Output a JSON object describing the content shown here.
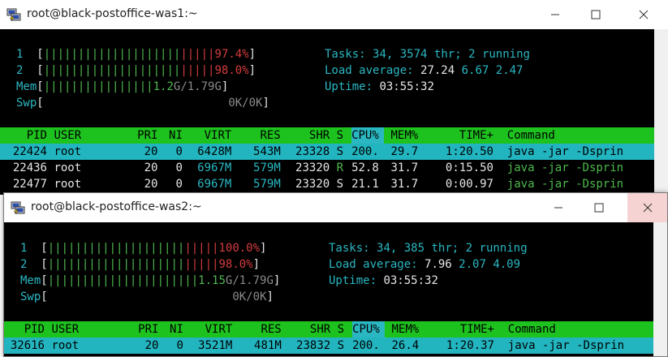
{
  "windows": [
    {
      "title": "root@black-postoffice-was1:~",
      "buttons": {
        "minimize": "—",
        "maximize": "☐",
        "close": "✕"
      },
      "cpu1": {
        "label": "1",
        "bar_green": "||||||||||||||||||||",
        "bar_red": "|||||",
        "value": "97.4%"
      },
      "cpu2": {
        "label": "2",
        "bar_green": "||||||||||||||||||||",
        "bar_red": "|||||",
        "value": "98.0%"
      },
      "mem": {
        "label": "Mem",
        "bar": "||||||||||||||||",
        "value": "1.2",
        "value2": "G/1.79G"
      },
      "swp": {
        "label": "Swp",
        "value": "0K/0K"
      },
      "tasks": {
        "label": "Tasks:",
        "count": "34,",
        "threads": "3574",
        "thr_label": "thr;",
        "running": "2",
        "running_label": "running"
      },
      "load": {
        "label": "Load average:",
        "v1": "27.24",
        "v2": "6.67",
        "v3": "2.47"
      },
      "uptime": {
        "label": "Uptime:",
        "value": "03:55:32"
      },
      "header": {
        "pid": "PID",
        "user": "USER",
        "pri": "PRI",
        "ni": "NI",
        "virt": "VIRT",
        "res": "RES",
        "shr": "SHR",
        "s": "S",
        "cpu": "CPU%",
        "mem": "MEM%",
        "time": "TIME+",
        "command": "Command"
      },
      "rows": [
        {
          "pid": "22424",
          "user": "root",
          "pri": "20",
          "ni": "0",
          "virt": "6428M",
          "res": "543M",
          "shr": "23328",
          "s": "S",
          "cpu": "200.",
          "mem": "29.7",
          "time": "1:20.50",
          "command": "java -jar -Dsprin"
        },
        {
          "pid": "22436",
          "user": "root",
          "pri": "20",
          "ni": "0",
          "virt": "6967M",
          "res": "579M",
          "shr": "23320",
          "s": "R",
          "cpu": "52.8",
          "mem": "31.7",
          "time": "0:15.50",
          "command": "java -jar -Dsprin"
        },
        {
          "pid": "22477",
          "user": "root",
          "pri": "20",
          "ni": "0",
          "virt": "6967M",
          "res": "579M",
          "shr": "23320",
          "s": "S",
          "cpu": "21.1",
          "mem": "31.7",
          "time": "0:00.97",
          "command": "java -jar -Dsprin"
        }
      ]
    },
    {
      "title": "root@black-postoffice-was2:~",
      "buttons": {
        "minimize": "—",
        "maximize": "☐",
        "close": "✕"
      },
      "cpu1": {
        "label": "1",
        "bar_green": "||||||||||||||||||||",
        "bar_red": "|||||",
        "value": "100.0%"
      },
      "cpu2": {
        "label": "2",
        "bar_green": "||||||||||||||||||||",
        "bar_red": "|||||",
        "value": "98.0%"
      },
      "mem": {
        "label": "Mem",
        "bar": "||||||||||||||||||||||",
        "value": "1.15",
        "value2": "G/1.79G"
      },
      "swp": {
        "label": "Swp",
        "value": "0K/0K"
      },
      "tasks": {
        "label": "Tasks:",
        "count": "34,",
        "threads": "385",
        "thr_label": "thr;",
        "running": "2",
        "running_label": "running"
      },
      "load": {
        "label": "Load average:",
        "v1": "7.96",
        "v2": "2.07",
        "v3": "4.09"
      },
      "uptime": {
        "label": "Uptime:",
        "value": "03:55:32"
      },
      "header": {
        "pid": "PID",
        "user": "USER",
        "pri": "PRI",
        "ni": "NI",
        "virt": "VIRT",
        "res": "RES",
        "shr": "SHR",
        "s": "S",
        "cpu": "CPU%",
        "mem": "MEM%",
        "time": "TIME+",
        "command": "Command"
      },
      "rows": [
        {
          "pid": "32616",
          "user": "root",
          "pri": "20",
          "ni": "0",
          "virt": "3521M",
          "res": "481M",
          "shr": "23832",
          "s": "S",
          "cpu": "200.",
          "mem": "26.4",
          "time": "1:20.37",
          "command": "java -jar -Dsprin"
        }
      ]
    }
  ]
}
